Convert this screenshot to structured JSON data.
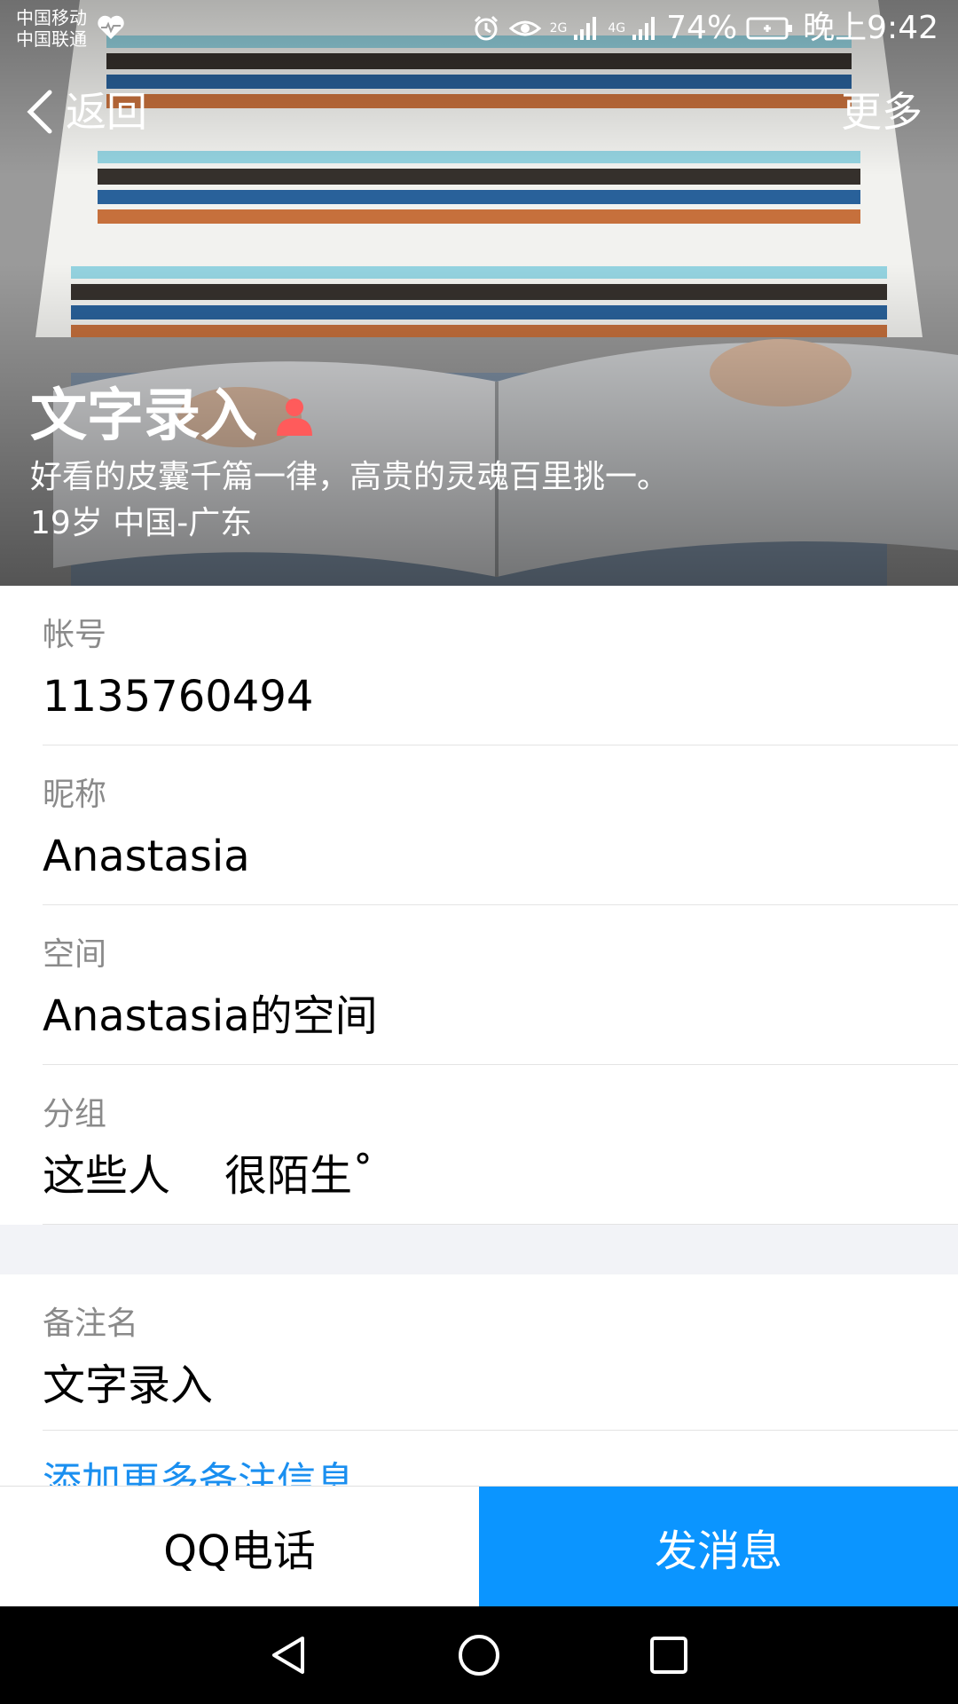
{
  "status_bar": {
    "carrier1": "中国移动",
    "carrier2": "中国联通",
    "net_2g": "2G",
    "net_4g": "4G",
    "battery": "74%",
    "time": "晚上9:42"
  },
  "nav": {
    "back_label": "返回",
    "more_label": "更多"
  },
  "profile": {
    "name": "文字录入",
    "signature": "好看的皮囊千篇一律，高贵的灵魂百里挑一。",
    "age_location": "19岁  中国-广东"
  },
  "info": {
    "account_label": "帐号",
    "account_value": "1135760494",
    "nickname_label": "昵称",
    "nickname_value": "Anastasia",
    "space_label": "空间",
    "space_value": "Anastasia的空间",
    "group_label": "分组",
    "group_value": "这些人    很陌生˚",
    "remark_label": "备注名",
    "remark_value": "文字录入",
    "add_more": "添加更多备注信息"
  },
  "actions": {
    "call_label": "QQ电话",
    "message_label": "发消息"
  },
  "colors": {
    "accent_blue": "#0b95ff",
    "link_blue": "#1a8ff0",
    "person_icon": "#ff5b5b"
  }
}
